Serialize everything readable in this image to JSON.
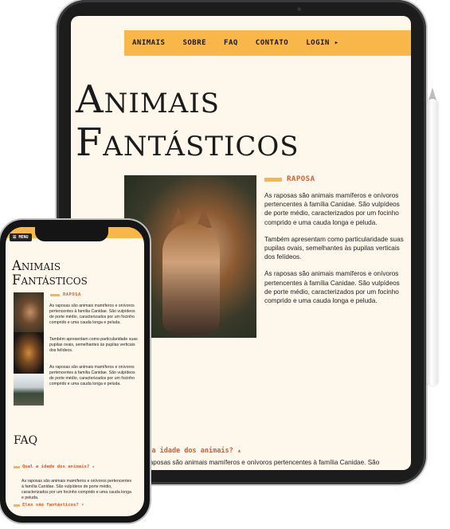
{
  "tablet": {
    "nav": [
      "ANIMAIS",
      "SOBRE",
      "FAQ",
      "CONTATO",
      "LOGIN ▸"
    ],
    "title_line1": "Animais",
    "title_line2": "Fantásticos",
    "section_label": "RAPOSA",
    "paragraphs": [
      "As raposas são animais mamíferos e onívoros pertencentes à família Canidae. São vulpídeos de porte médio, caracterizados por um focinho comprido e uma cauda longa e peluda.",
      "Também apresentam como particularidade suas pupilas ovais, semelhantes às pupilas verticais dos felídeos.",
      "As raposas são animais mamíferos e onívoros pertencentes à família Canidae. São vulpídeos de porte médio, caracterizados por um focinho comprido e uma cauda longa e peluda."
    ],
    "faq_question": "al a idade dos animais? ▴",
    "faq_answer": "raposas são animais mamíferos e onívoros pertencentes à família Canidae. São"
  },
  "phone": {
    "menu_button": "☰ MENU",
    "title_line1": "Animais",
    "title_line2": "Fantásticos",
    "section_label": "RAPOSA",
    "paragraphs": [
      "As raposas são animais mamíferos e onívoros pertencentes à família Canidae. São vulpídeos de porte médio, caracterizados por um focinho comprido e uma cauda longa e peluda.",
      "Também apresentam como particularidade suas pupilas ovais, semelhantes às pupilas verticais dos felídeos.",
      "As raposas são animais mamíferos e onívoros pertencentes à família Canidae. São vulpídeos de porte médio, caracterizados por um focinho comprido e uma cauda longa e peluda."
    ],
    "faq_heading": "FAQ",
    "faq_q1": "Qual a idade dos animais? ▴",
    "faq_a1": "As raposas são animais mamíferos e onívoros pertencentes à família Canidae. São vulpídeos de porte médio, caracterizados por um focinho comprido e uma cauda longa e peluda.",
    "faq_q2": "Eles são fantásticos? ▾"
  },
  "colors": {
    "accent": "#f9b74a",
    "label": "#e2582a",
    "page_bg": "#fdf7ec"
  }
}
